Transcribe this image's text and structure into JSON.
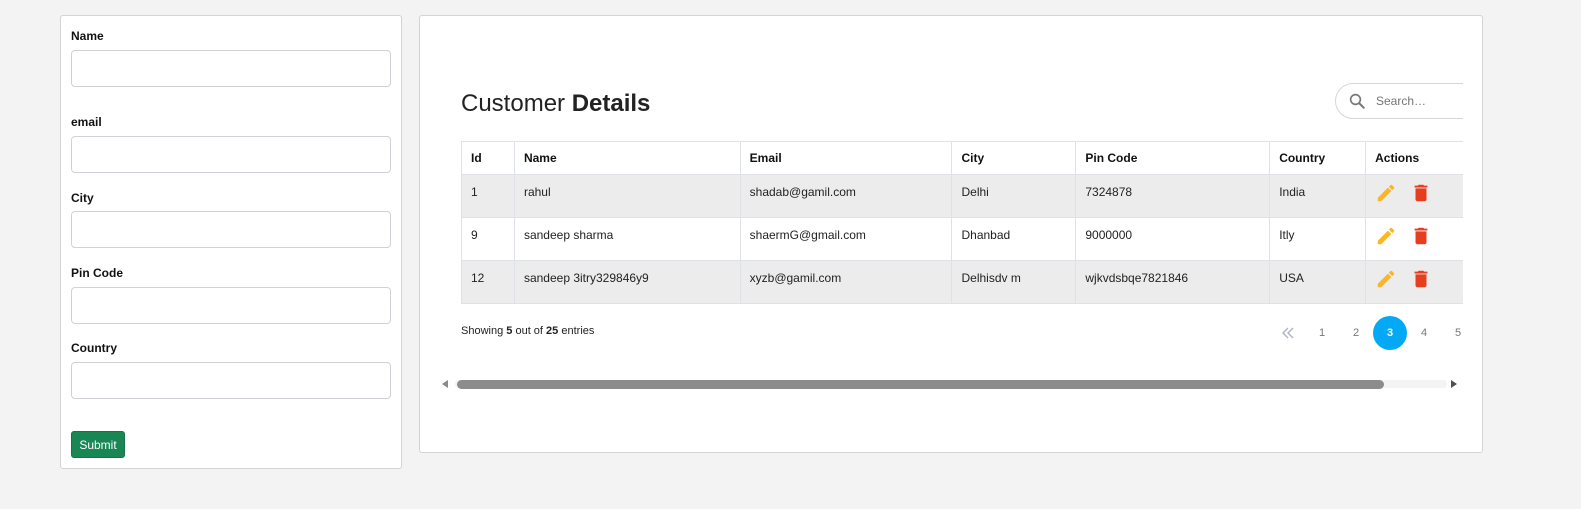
{
  "form": {
    "fields": [
      {
        "label": "Name",
        "value": "",
        "placeholder": ""
      },
      {
        "label": "email",
        "value": "",
        "placeholder": ""
      },
      {
        "label": "City",
        "value": "",
        "placeholder": ""
      },
      {
        "label": "Pin Code",
        "value": "",
        "placeholder": ""
      },
      {
        "label": "Country",
        "value": "",
        "placeholder": ""
      }
    ],
    "submit_label": "Submit"
  },
  "customers": {
    "title_light": "Customer",
    "title_bold": "Details",
    "search": {
      "placeholder": "Search…",
      "icon": "search-icon"
    },
    "columns": [
      "Id",
      "Name",
      "Email",
      "City",
      "Pin Code",
      "Country",
      "Actions"
    ],
    "rows": [
      {
        "id": "1",
        "name": "rahul",
        "email": "shadab@gamil.com",
        "city": "Delhi",
        "pin": "7324878",
        "country": "India"
      },
      {
        "id": "9",
        "name": "sandeep sharma",
        "email": "shaermG@gmail.com",
        "city": "Dhanbad",
        "pin": "9000000",
        "country": "Itly"
      },
      {
        "id": "12",
        "name": "sandeep 3itry329846y9",
        "email": "xyzb@gamil.com",
        "city": "Delhisdv m",
        "pin": "wjkvdsbqe7821846",
        "country": "USA"
      }
    ],
    "actions": {
      "edit_icon": "pencil-icon",
      "delete_icon": "trash-icon"
    },
    "colors": {
      "edit": "#fbb626",
      "delete": "#e53f1f",
      "active_page": "#03a9f4",
      "submit": "#198754"
    }
  },
  "footer": {
    "prefix": "Showing",
    "shown": "5",
    "middle": "out of",
    "total": "25",
    "suffix": "entries"
  },
  "pagination": {
    "first_icon": "double-chevron-left-icon",
    "pages": [
      "1",
      "2",
      "3",
      "4",
      "5"
    ],
    "active": "3"
  },
  "scrollbar": {
    "visible_fraction": 0.92,
    "position_fraction": 0
  }
}
